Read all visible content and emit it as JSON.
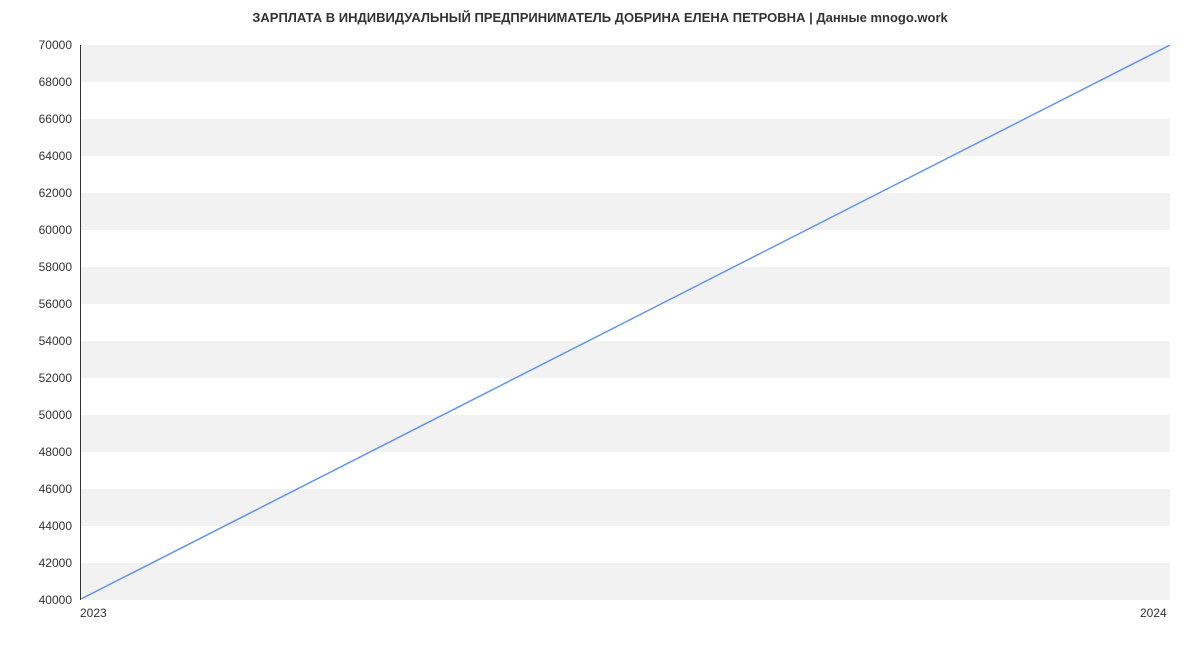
{
  "chart_data": {
    "type": "line",
    "title": "ЗАРПЛАТА В ИНДИВИДУАЛЬНЫЙ ПРЕДПРИНИМАТЕЛЬ ДОБРИНА ЕЛЕНА ПЕТРОВНА | Данные mnogo.work",
    "x": [
      "2023",
      "2024"
    ],
    "values": [
      40000,
      70000
    ],
    "xlabel": "",
    "ylabel": "",
    "ylim": [
      40000,
      70000
    ],
    "y_ticks": [
      40000,
      42000,
      44000,
      46000,
      48000,
      50000,
      52000,
      54000,
      56000,
      58000,
      60000,
      62000,
      64000,
      66000,
      68000,
      70000
    ],
    "x_ticks": [
      "2023",
      "2024"
    ],
    "line_color": "#6495ED"
  }
}
